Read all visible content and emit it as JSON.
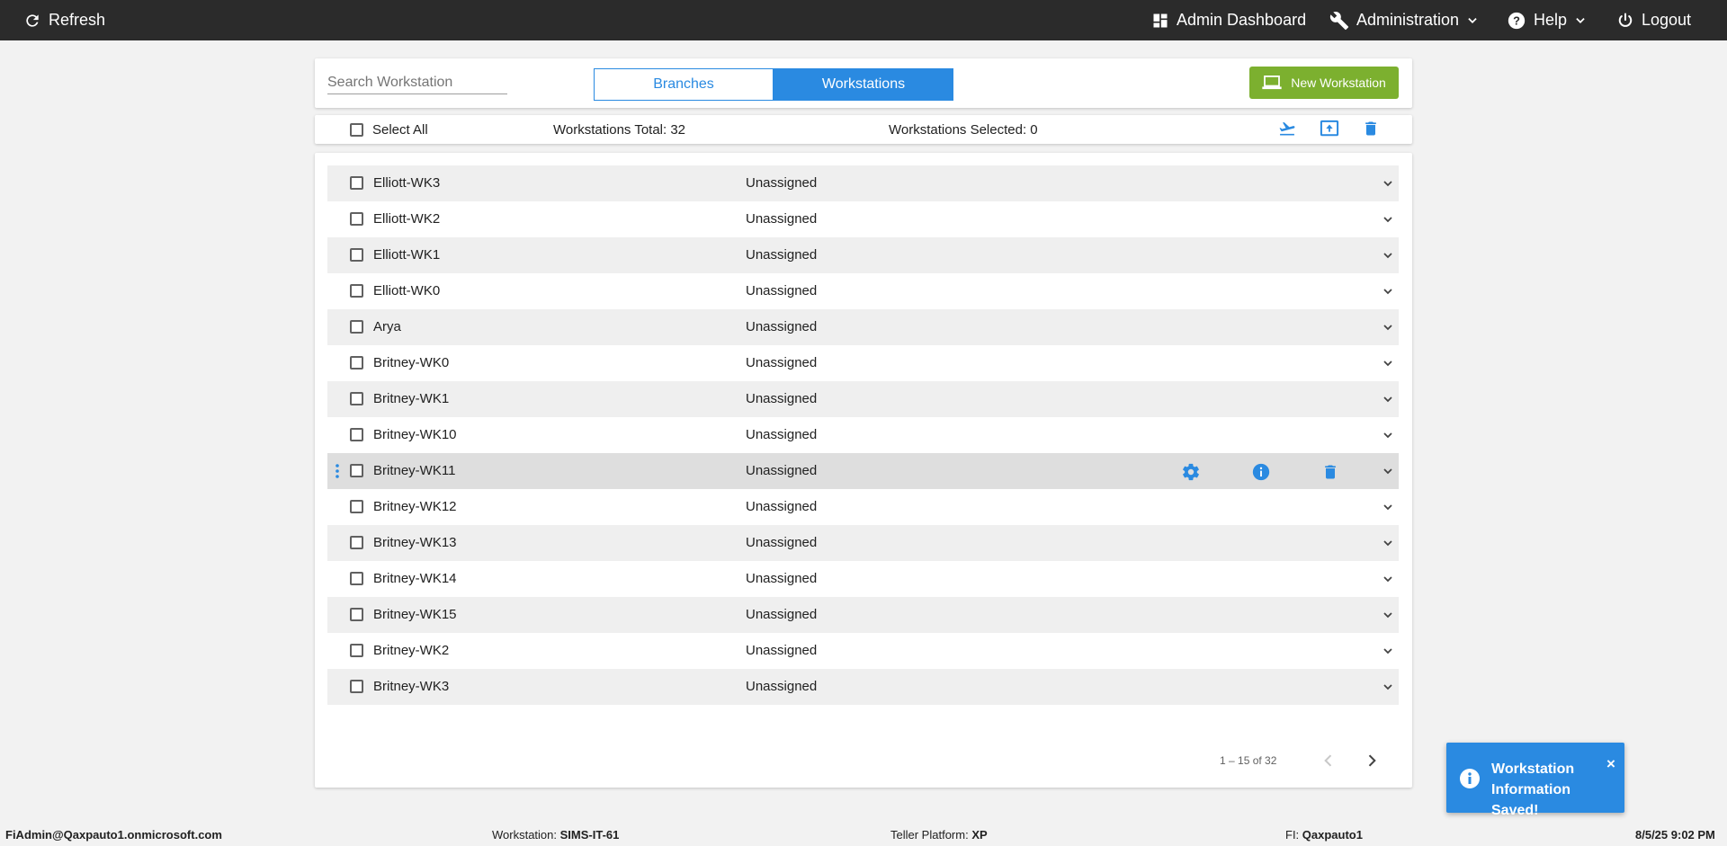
{
  "topbar": {
    "refresh": "Refresh",
    "admin_dashboard": "Admin Dashboard",
    "administration": "Administration",
    "help": "Help",
    "logout": "Logout"
  },
  "header": {
    "search_placeholder": "Search Workstation",
    "tabs": [
      "Branches",
      "Workstations"
    ],
    "active_tab": "Workstations",
    "new_button": "New Workstation"
  },
  "toolbar": {
    "select_all": "Select All",
    "total": "Workstations Total: 32",
    "selected": "Workstations Selected: 0"
  },
  "rows": [
    {
      "name": "Elliott-WK3",
      "status": "Unassigned"
    },
    {
      "name": "Elliott-WK2",
      "status": "Unassigned"
    },
    {
      "name": "Elliott-WK1",
      "status": "Unassigned"
    },
    {
      "name": "Elliott-WK0",
      "status": "Unassigned"
    },
    {
      "name": "Arya",
      "status": "Unassigned"
    },
    {
      "name": "Britney-WK0",
      "status": "Unassigned"
    },
    {
      "name": "Britney-WK1",
      "status": "Unassigned"
    },
    {
      "name": "Britney-WK10",
      "status": "Unassigned"
    },
    {
      "name": "Britney-WK11",
      "status": "Unassigned"
    },
    {
      "name": "Britney-WK12",
      "status": "Unassigned"
    },
    {
      "name": "Britney-WK13",
      "status": "Unassigned"
    },
    {
      "name": "Britney-WK14",
      "status": "Unassigned"
    },
    {
      "name": "Britney-WK15",
      "status": "Unassigned"
    },
    {
      "name": "Britney-WK2",
      "status": "Unassigned"
    },
    {
      "name": "Britney-WK3",
      "status": "Unassigned"
    }
  ],
  "pager": {
    "range": "1 – 15 of 32"
  },
  "toast": {
    "message": "Workstation Information Saved!",
    "close": "×"
  },
  "status": {
    "user": "FiAdmin@Qaxpauto1.onmicrosoft.com",
    "workstation_label": "Workstation:",
    "workstation_value": "SIMS-IT-61",
    "platform_label": "Teller Platform:",
    "platform_value": "XP",
    "fi_label": "FI:",
    "fi_value": "Qaxpauto1",
    "datetime": "8/5/25 9:02 PM"
  },
  "colors": {
    "primary": "#2a8ae1",
    "success": "#7cb02f",
    "topbar": "#2b2b2b"
  }
}
